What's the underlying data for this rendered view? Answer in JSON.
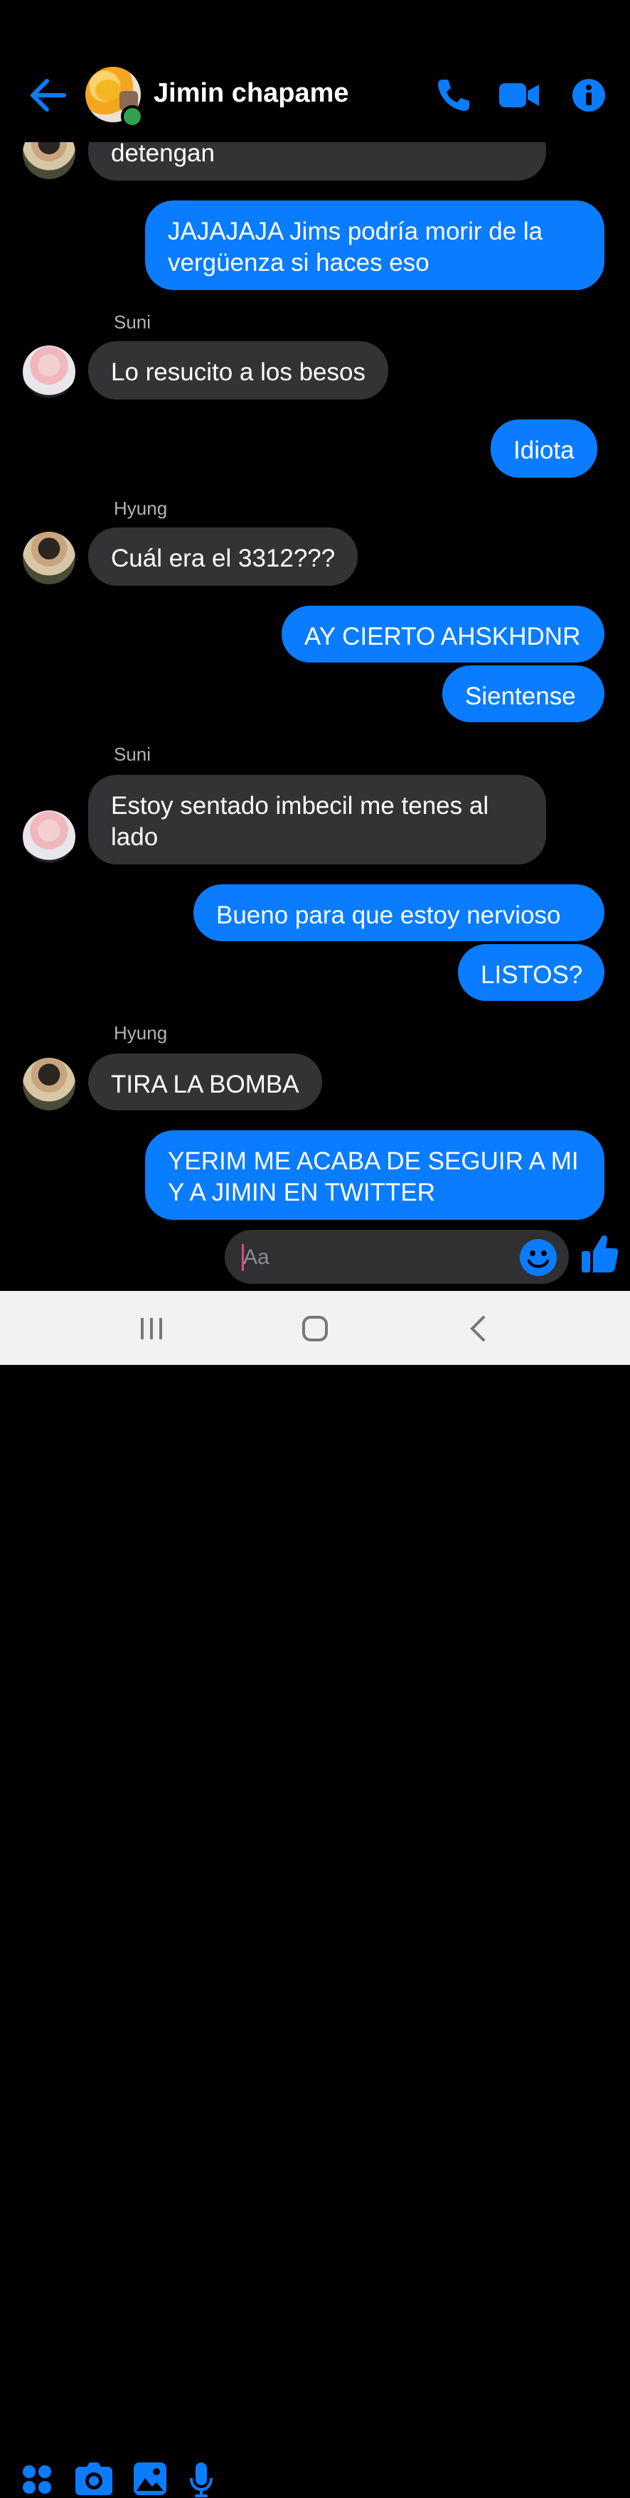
{
  "header": {
    "title": "Jimin chapame",
    "back_icon": "back-arrow-icon",
    "call_icon": "phone-icon",
    "video_icon": "video-camera-icon",
    "info_icon": "info-icon"
  },
  "colors": {
    "accent": "#0a7cff",
    "incoming_bubble": "#333336",
    "background": "#000000",
    "online": "#31a24c"
  },
  "messages": {
    "m0": "detengan",
    "m1": "JAJAJAJA Jims podría morir de la vergüenza si haces eso",
    "s1": "Suni",
    "m2": "Lo resucito a los besos",
    "m3": "Idiota",
    "s2": "Hyung",
    "m4": "Cuál era el 3312???",
    "m5": "AY CIERTO AHSKHDNR",
    "m6": "Sientense",
    "s3": "Suni",
    "m7": "Estoy sentado imbecil me tenes al lado",
    "m8": "Bueno para que estoy nervioso",
    "m9": "LISTOS?",
    "s4": "Hyung",
    "m10": "TIRA LA BOMBA",
    "m11": "YERIM ME ACABA DE SEGUIR A MI Y A JIMIN EN TWITTER"
  },
  "composer": {
    "placeholder": "Aa"
  }
}
